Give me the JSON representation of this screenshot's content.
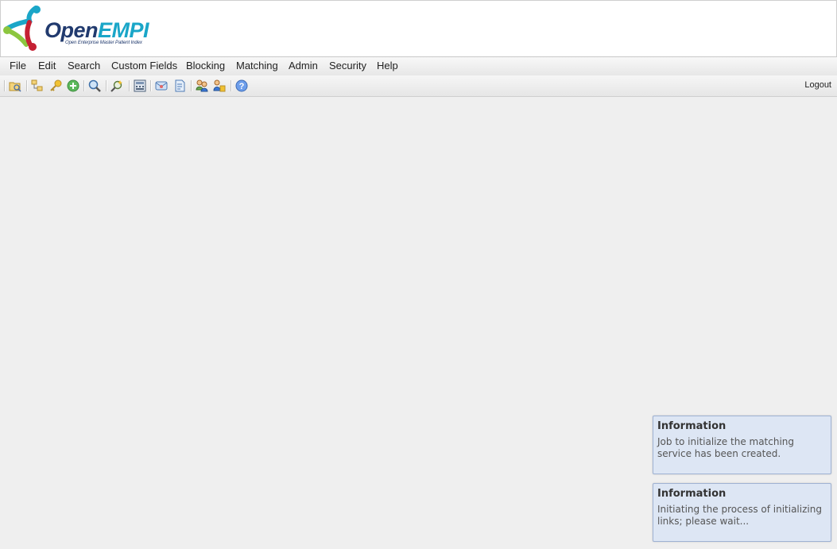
{
  "logo": {
    "text_open": "Open",
    "text_empi": "EMPI",
    "tagline": "Open Enterprise Master Patient Index"
  },
  "menu": {
    "items": [
      "File",
      "Edit",
      "Search",
      "Custom Fields",
      "Blocking",
      "Matching",
      "Admin",
      "Security",
      "Help"
    ]
  },
  "toolbar": {
    "icons": [
      "open-folder-icon",
      "tree-icon",
      "key-icon",
      "add-icon",
      "search-icon",
      "magic-search-icon",
      "calculator-icon",
      "mail-icon",
      "document-icon",
      "users-icon",
      "user-link-icon",
      "help-icon"
    ],
    "logout_label": "Logout"
  },
  "notifications": [
    {
      "title": "Information",
      "message": "Job to initialize the matching service has been created."
    },
    {
      "title": "Information",
      "message": "Initiating the process of initializing links; please wait..."
    }
  ]
}
